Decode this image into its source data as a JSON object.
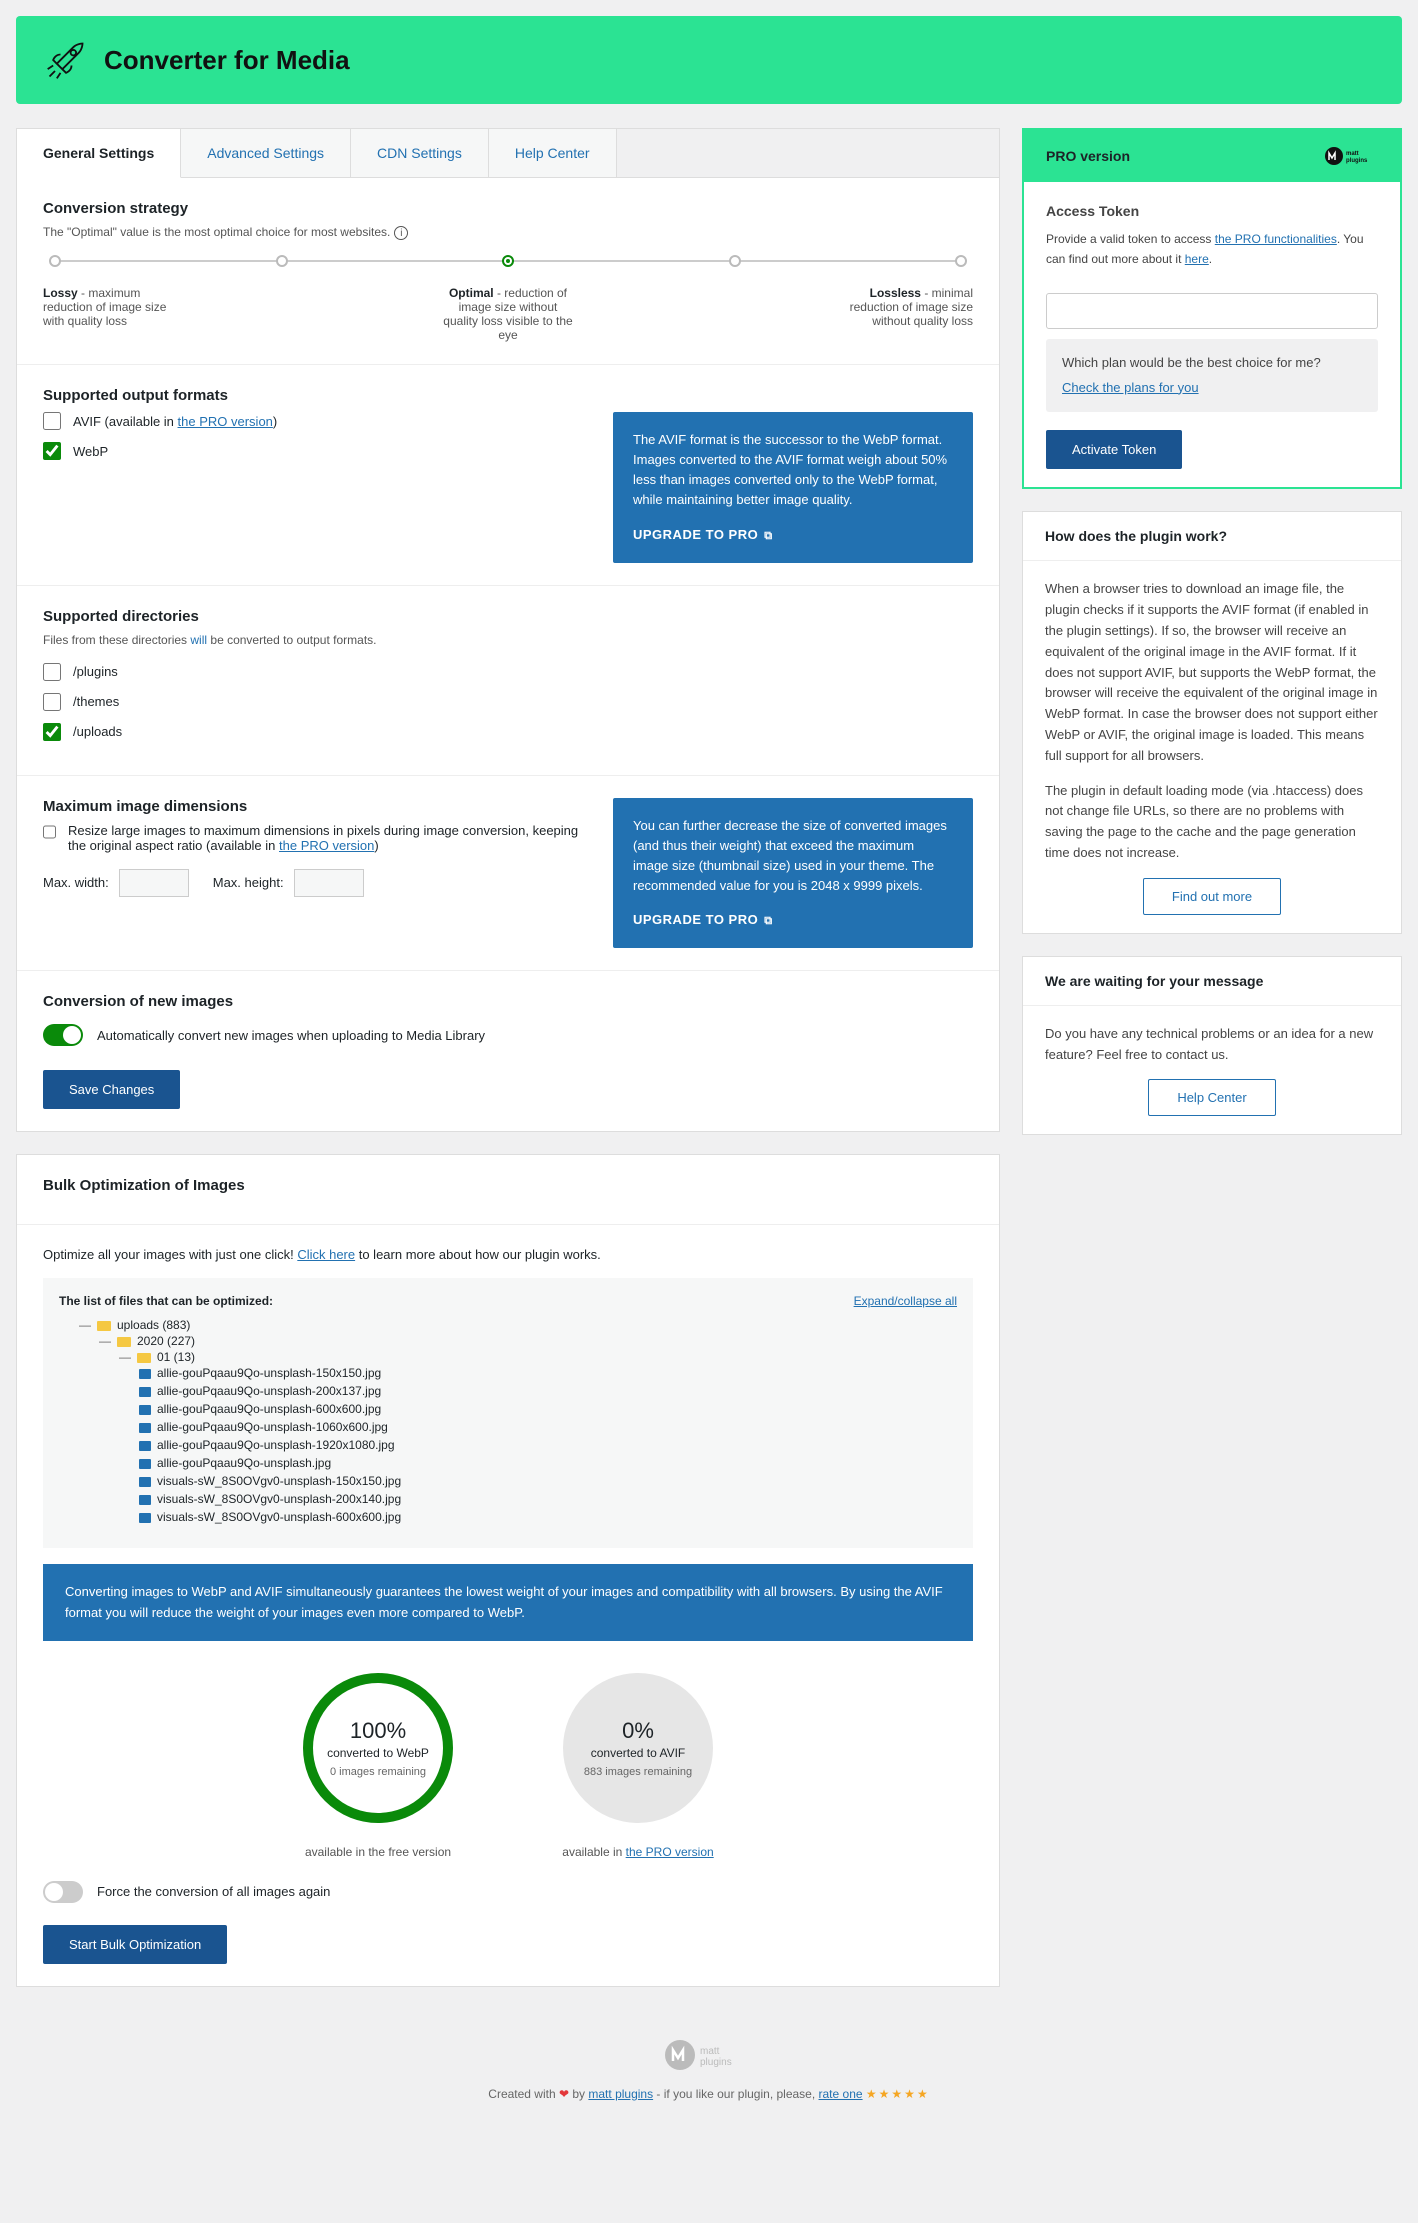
{
  "header": {
    "title": "Converter for Media"
  },
  "tabs": [
    "General Settings",
    "Advanced Settings",
    "CDN Settings",
    "Help Center"
  ],
  "strategy": {
    "heading": "Conversion strategy",
    "desc": "The \"Optimal\" value is the most optimal choice for most websites.",
    "points": [
      {
        "title": "Lossy",
        "text": " - maximum reduction of image size with quality loss"
      },
      {
        "title": "Optimal",
        "text": " - reduction of image size without quality loss visible to the eye"
      },
      {
        "title": "Lossless",
        "text": " - minimal reduction of image size without quality loss"
      }
    ]
  },
  "formats": {
    "heading": "Supported output formats",
    "avif_label": "AVIF (available in ",
    "pro_link": "the PRO version",
    "avif_close": ")",
    "webp_label": "WebP",
    "promo": "The AVIF format is the successor to the WebP format. Images converted to the AVIF format weigh about 50% less than images converted only to the WebP format, while maintaining better image quality.",
    "cta": "UPGRADE TO PRO"
  },
  "dirs": {
    "heading": "Supported directories",
    "desc_a": "Files from these directories ",
    "desc_b": "will",
    "desc_c": " be converted to output formats.",
    "items": [
      "/plugins",
      "/themes",
      "/uploads"
    ]
  },
  "maxdim": {
    "heading": "Maximum image dimensions",
    "chk_a": "Resize large images to maximum dimensions in pixels during image conversion, keeping the original aspect ratio (available in ",
    "chk_b": "the PRO version",
    "chk_c": ")",
    "w": "Max. width:",
    "h": "Max. height:",
    "promo": "You can further decrease the size of converted images (and thus their weight) that exceed the maximum image size (thumbnail size) used in your theme. The recommended value for you is 2048 x 9999 pixels.",
    "cta": "UPGRADE TO PRO"
  },
  "convnew": {
    "heading": "Conversion of new images",
    "label": "Automatically convert new images when uploading to Media Library",
    "save": "Save Changes"
  },
  "bulk": {
    "heading": "Bulk Optimization of Images",
    "intro_a": "Optimize all your images with just one click! ",
    "intro_link": "Click here",
    "intro_b": " to learn more about how our plugin works.",
    "list_head": "The list of files that can be optimized:",
    "expand": "Expand/collapse all",
    "tree": {
      "root": "uploads (883)",
      "year": "2020 (227)",
      "month": "01 (13)",
      "files": [
        "allie-gouPqaau9Qo-unsplash-150x150.jpg",
        "allie-gouPqaau9Qo-unsplash-200x137.jpg",
        "allie-gouPqaau9Qo-unsplash-600x600.jpg",
        "allie-gouPqaau9Qo-unsplash-1060x600.jpg",
        "allie-gouPqaau9Qo-unsplash-1920x1080.jpg",
        "allie-gouPqaau9Qo-unsplash.jpg",
        "visuals-sW_8S0OVgv0-unsplash-150x150.jpg",
        "visuals-sW_8S0OVgv0-unsplash-200x140.jpg",
        "visuals-sW_8S0OVgv0-unsplash-600x600.jpg"
      ]
    },
    "promo": "Converting images to WebP and AVIF simultaneously guarantees the lowest weight of your images and compatibility with all browsers. By using the AVIF format you will reduce the weight of your images even more compared to WebP.",
    "c1": {
      "pct": "100%",
      "lbl": "converted to WebP",
      "sub": "0 images remaining",
      "cap": "available in the free version"
    },
    "c2": {
      "pct": "0%",
      "lbl": "converted to AVIF",
      "sub": "883 images remaining",
      "cap_a": "available in ",
      "cap_b": "the PRO version"
    },
    "force": "Force the conversion of all images again",
    "start": "Start Bulk Optimization"
  },
  "pro": {
    "title": "PRO version",
    "at": "Access Token",
    "desc_a": "Provide a valid token to access ",
    "desc_link": "the PRO functionalities",
    "desc_b": ". You can find out more about it ",
    "desc_here": "here",
    "desc_c": ".",
    "plan_q": "Which plan would be the best choice for me?",
    "plan_link": "Check the plans for you",
    "activate": "Activate Token"
  },
  "how": {
    "title": "How does the plugin work?",
    "p1": "When a browser tries to download an image file, the plugin checks if it supports the AVIF format (if enabled in the plugin settings). If so, the browser will receive an equivalent of the original image in the AVIF format. If it does not support AVIF, but supports the WebP format, the browser will receive the equivalent of the original image in WebP format. In case the browser does not support either WebP or AVIF, the original image is loaded. This means full support for all browsers.",
    "p2": "The plugin in default loading mode (via .htaccess) does not change file URLs, so there are no problems with saving the page to the cache and the page generation time does not increase.",
    "btn": "Find out more"
  },
  "msg": {
    "title": "We are waiting for your message",
    "body": "Do you have any technical problems or an idea for a new feature? Feel free to contact us.",
    "btn": "Help Center"
  },
  "footer": {
    "a": "Created with ",
    "b": " by ",
    "c": "matt plugins",
    "d": " - if you like our plugin, please, ",
    "e": "rate one"
  }
}
